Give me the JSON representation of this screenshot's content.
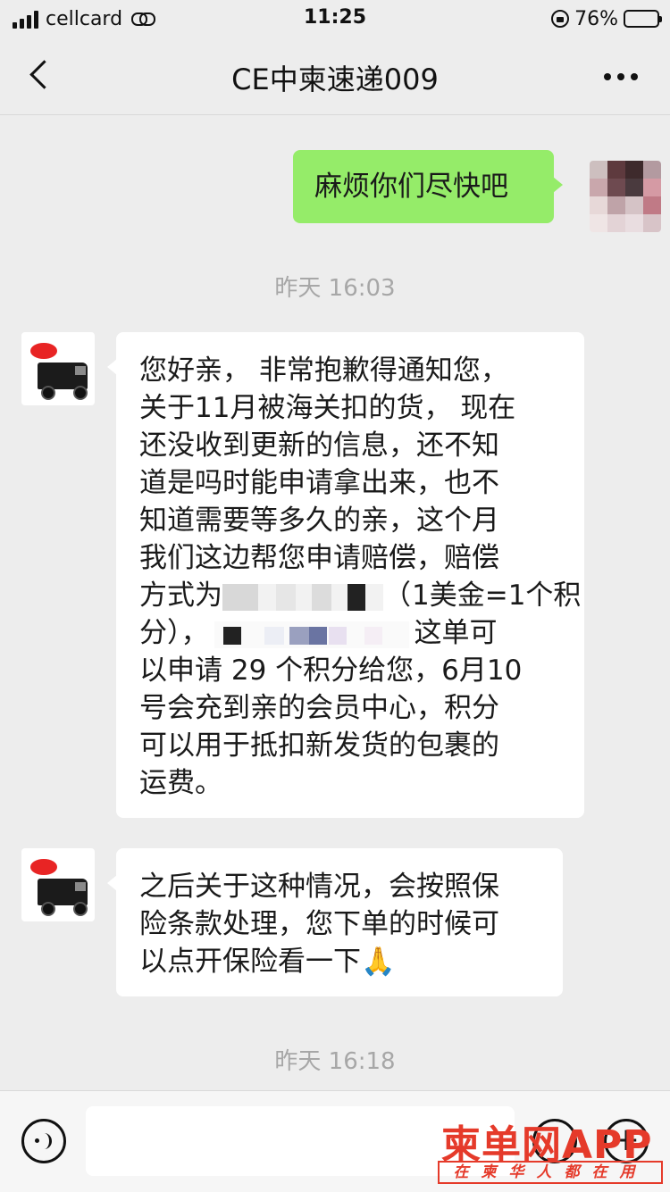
{
  "status_bar": {
    "carrier": "cellcard",
    "time": "11:25",
    "battery": "76%",
    "battery_level": 0.76,
    "icons": [
      "signal-icon",
      "link-icon",
      "rotation-lock-icon",
      "battery-icon"
    ]
  },
  "nav": {
    "title": "CE中柬速递009",
    "icons": [
      "back-icon",
      "more-icon"
    ]
  },
  "messages": [
    {
      "direction": "out",
      "text": "麻烦你们尽快吧"
    },
    {
      "type": "timestamp",
      "text": "昨天 16:03"
    },
    {
      "direction": "in",
      "lines": [
        "您好亲， 非常抱歉得通知您，",
        "关于11月被海关扣的货， 现在",
        "还没收到更新的信息，还不知",
        "道是吗时能申请拿出来，也不",
        "知道需要等多久的亲，这个月",
        "我们这边帮您申请赔偿，赔偿",
        "方式为",
        "1美金=1个积",
        "分）",
        "这单可",
        "以申请 29 个积分给您，6月10",
        "号会充到亲的会员中心，积分",
        "可以用于抵扣新发货的包裹的",
        "运费。"
      ]
    },
    {
      "direction": "in",
      "lines": [
        "之后关于这种情况，会按照保",
        "险条款处理，您下单的时候可",
        "以点开保险看一下"
      ],
      "emoji": "🙏"
    },
    {
      "type": "timestamp",
      "text": "昨天 16:18"
    }
  ],
  "input_bar": {
    "icons": [
      "voice-icon",
      "emoji-icon",
      "plus-icon"
    ]
  },
  "watermark": {
    "main": "柬单网APP",
    "sub": "在柬华人都在用"
  },
  "colors": {
    "background": "#ededed",
    "outgoing_bubble": "#95ec69",
    "incoming_bubble": "#ffffff",
    "timestamp": "#a7a7a7",
    "watermark": "#e53a2a"
  }
}
